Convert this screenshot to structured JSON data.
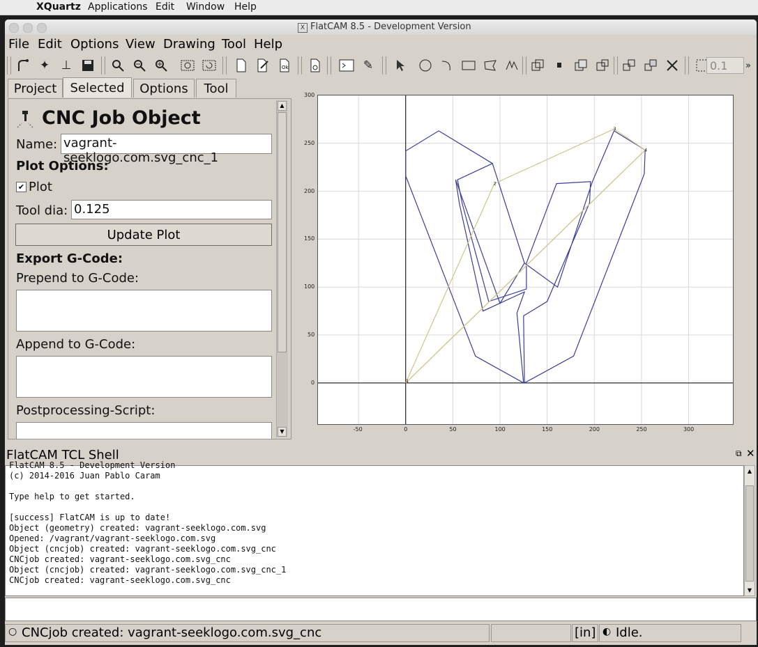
{
  "mac_menubar": {
    "app_name": "XQuartz",
    "items": [
      "Applications",
      "Edit",
      "Window",
      "Help"
    ]
  },
  "window": {
    "title": "FlatCAM 8.5 - Development Version"
  },
  "menubar": {
    "items": [
      "File",
      "Edit",
      "Options",
      "View",
      "Drawing",
      "Tool",
      "Help"
    ]
  },
  "toolbar": {
    "grid_value": "0.1"
  },
  "tabs": [
    "Project",
    "Selected",
    "Options",
    "Tool"
  ],
  "selected_panel": {
    "heading": "CNC Job Object",
    "name_label": "Name:",
    "name_value": "vagrant-seeklogo.com.svg_cnc_1",
    "plot_options_label": "Plot Options:",
    "plot_checkbox_label": "Plot",
    "plot_checkbox_checked": "✔",
    "tool_dia_label": "Tool dia:",
    "tool_dia_value": "0.125",
    "update_plot_label": "Update Plot",
    "export_label": "Export G-Code:",
    "prepend_label": "Prepend to G-Code:",
    "append_label": "Append to G-Code:",
    "postprocessing_label": "Postprocessing-Script:"
  },
  "chart_data": {
    "type": "line",
    "xlim": [
      -93,
      347
    ],
    "ylim": [
      -43,
      300
    ],
    "xticks": [
      -50,
      0,
      50,
      100,
      150,
      200,
      250,
      300
    ],
    "yticks": [
      0,
      50,
      100,
      150,
      200,
      250,
      300
    ],
    "grid": true,
    "series": [
      {
        "color": "#3c3c9c",
        "points": [
          [
            0,
            216
          ],
          [
            0,
            242
          ],
          [
            35,
            263
          ],
          [
            92,
            229
          ],
          [
            126,
            125
          ],
          [
            100,
            83
          ],
          [
            53,
            212
          ],
          [
            57,
            187
          ],
          [
            82,
            75
          ],
          [
            126,
            95
          ],
          [
            118,
            73
          ],
          [
            125,
            0
          ],
          [
            74,
            28
          ],
          [
            0,
            216
          ]
        ]
      },
      {
        "color": "#3c3c9c",
        "points": [
          [
            92,
            229
          ],
          [
            55,
            212
          ],
          [
            60,
            187
          ],
          [
            88,
            85
          ],
          [
            128,
            98
          ],
          [
            128,
            125
          ]
        ]
      },
      {
        "color": "#3c3c9c",
        "points": [
          [
            126,
            125
          ],
          [
            161,
            100
          ],
          [
            198,
            210
          ],
          [
            221,
            263
          ],
          [
            254,
            243
          ],
          [
            253,
            218
          ],
          [
            178,
            28
          ],
          [
            126,
            0
          ],
          [
            125,
            70
          ],
          [
            150,
            85
          ],
          [
            195,
            188
          ],
          [
            196,
            210
          ],
          [
            160,
            208
          ],
          [
            128,
            125
          ]
        ]
      },
      {
        "color": "#cfc68c",
        "points": [
          [
            0,
            0
          ],
          [
            94,
            208
          ],
          [
            221,
            265
          ],
          [
            254,
            243
          ],
          [
            0,
            0
          ]
        ]
      },
      {
        "color": "#cfc68c",
        "points": [
          [
            0,
            0
          ],
          [
            254,
            243
          ]
        ]
      }
    ],
    "markers": [
      {
        "x": 1,
        "y": 2,
        "label": "1"
      },
      {
        "x": 94,
        "y": 208,
        "label": "2"
      },
      {
        "x": 221,
        "y": 265,
        "label": "3"
      },
      {
        "x": 254,
        "y": 243,
        "label": "4"
      }
    ]
  },
  "shell": {
    "title": "FlatCAM TCL Shell",
    "lines": [
      "FlatCAM 8.5 - Development Version",
      "(c) 2014-2016 Juan Pablo Caram",
      "",
      "Type help to get started.",
      "",
      "[success] FlatCAM is up to date!",
      "Object (geometry) created: vagrant-seeklogo.com.svg",
      "Opened: /vagrant/vagrant-seeklogo.com.svg",
      "Object (cncjob) created: vagrant-seeklogo.com.svg_cnc",
      "CNCjob created: vagrant-seeklogo.com.svg_cnc",
      "Object (cncjob) created: vagrant-seeklogo.com.svg_cnc_1",
      "CNCjob created: vagrant-seeklogo.com.svg_cnc"
    ]
  },
  "statusbar": {
    "message": "CNCjob created: vagrant-seeklogo.com.svg_cnc",
    "units": "[in]",
    "state": "Idle."
  }
}
